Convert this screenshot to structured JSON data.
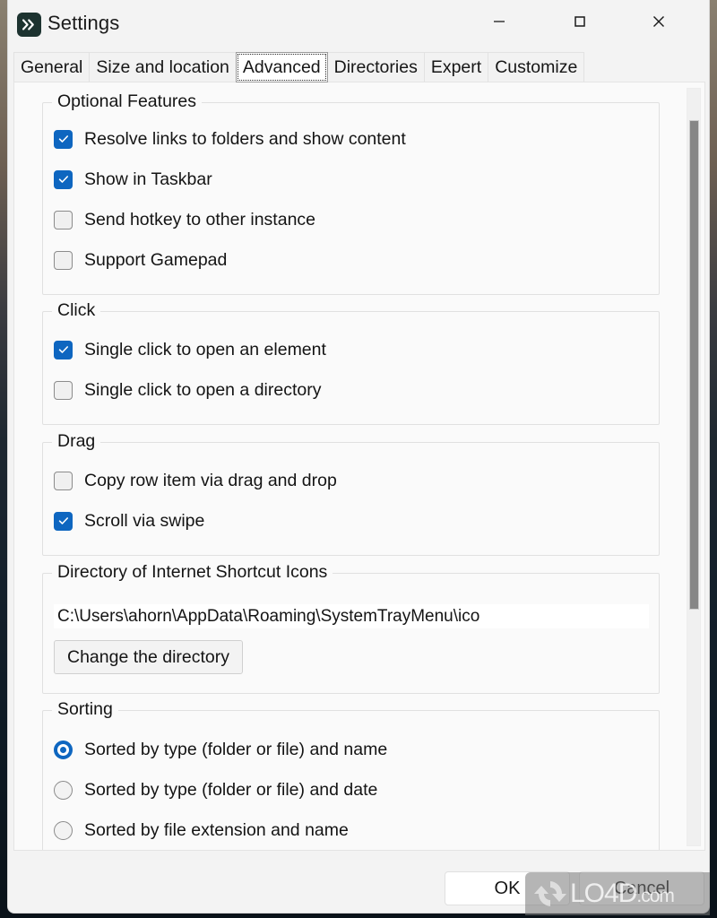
{
  "window": {
    "title": "Settings",
    "app_icon": "chevron-double-right-icon",
    "controls": {
      "minimize": "minimize-icon",
      "maximize": "maximize-icon",
      "close": "close-icon"
    }
  },
  "tabs": [
    {
      "label": "General",
      "selected": false
    },
    {
      "label": "Size and location",
      "selected": false
    },
    {
      "label": "Advanced",
      "selected": true
    },
    {
      "label": "Directories",
      "selected": false
    },
    {
      "label": "Expert",
      "selected": false
    },
    {
      "label": "Customize",
      "selected": false
    }
  ],
  "groups": {
    "optional_features": {
      "title": "Optional Features",
      "items": [
        {
          "label": "Resolve links to folders and show content",
          "checked": true
        },
        {
          "label": "Show in Taskbar",
          "checked": true
        },
        {
          "label": "Send hotkey to other instance",
          "checked": false
        },
        {
          "label": "Support Gamepad",
          "checked": false
        }
      ]
    },
    "click": {
      "title": "Click",
      "items": [
        {
          "label": "Single click to open an element",
          "checked": true
        },
        {
          "label": "Single click to open a directory",
          "checked": false
        }
      ]
    },
    "drag": {
      "title": "Drag",
      "items": [
        {
          "label": "Copy row item via drag and drop",
          "checked": false
        },
        {
          "label": "Scroll via swipe",
          "checked": true
        }
      ]
    },
    "shortcut_icons": {
      "title": "Directory of Internet Shortcut Icons",
      "path_value": "C:\\Users\\ahorn\\AppData\\Roaming\\SystemTrayMenu\\ico",
      "path_placeholder": "",
      "change_button": "Change the directory"
    },
    "sorting": {
      "title": "Sorting",
      "options": [
        {
          "label": "Sorted by type (folder or file) and name",
          "selected": true
        },
        {
          "label": "Sorted by type (folder or file) and date",
          "selected": false
        },
        {
          "label": "Sorted by file extension and name",
          "selected": false
        }
      ]
    }
  },
  "footer": {
    "ok_label": "OK",
    "cancel_label": "Cancel"
  },
  "watermark": {
    "text_main": "LO4D",
    "text_suffix": ".com"
  },
  "colors": {
    "accent": "#0e66c0",
    "window_bg": "#f3f3f3",
    "panel_bg": "#fafafa",
    "scroll_thumb": "#868686"
  }
}
